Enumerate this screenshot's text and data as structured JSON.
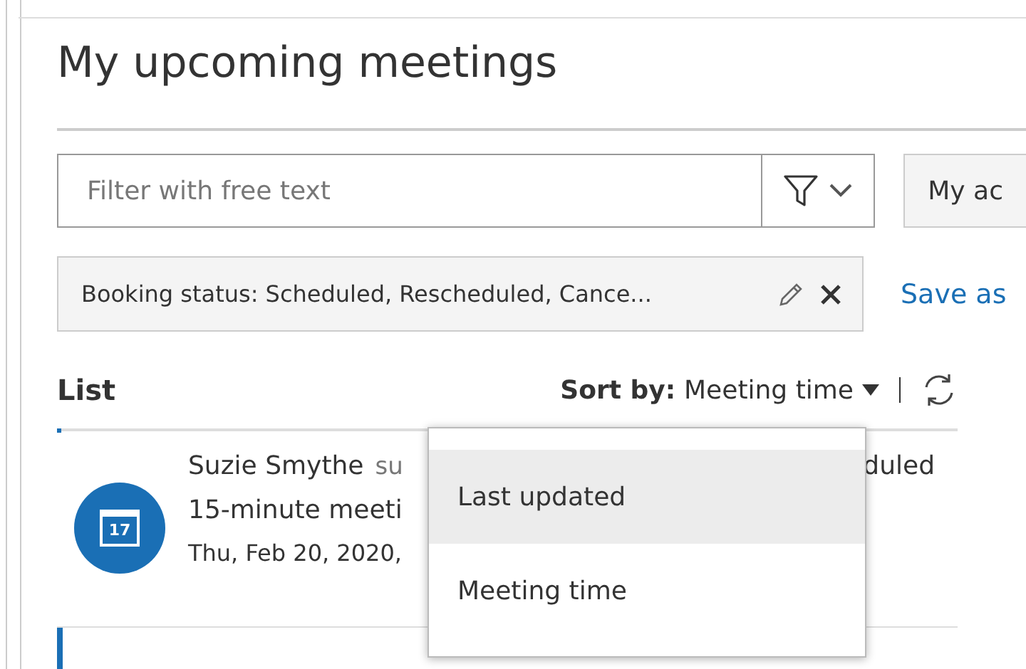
{
  "page": {
    "title": "My upcoming meetings"
  },
  "filter": {
    "placeholder": "Filter with free text",
    "view_button": "My ac"
  },
  "chips": [
    {
      "label": "Booking status: Scheduled, Rescheduled, Cance..."
    }
  ],
  "save_link": "Save as",
  "list": {
    "title": "List",
    "sort_label": "Sort by:",
    "sort_value": "Meeting time",
    "rows": [
      {
        "name": "Suzie Smythe",
        "email": "su",
        "status": "duled",
        "meeting": "15-minute meeti",
        "date": "Thu, Feb 20, 2020,",
        "day": "17",
        "selected": false
      }
    ]
  },
  "sort_menu": [
    {
      "label": "Last updated",
      "selected": true
    },
    {
      "label": "Meeting time",
      "selected": false
    }
  ]
}
